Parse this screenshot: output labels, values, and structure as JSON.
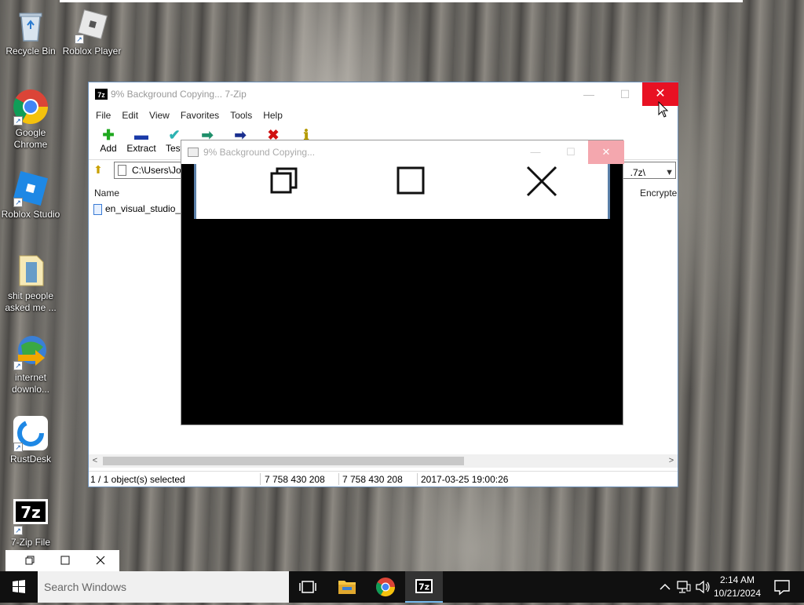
{
  "desktop": {
    "icons": [
      {
        "label": "Recycle Bin"
      },
      {
        "label": "Roblox Player"
      },
      {
        "label": "Google Chrome"
      },
      {
        "label": "Roblox Studio"
      },
      {
        "label": "shit people asked me ..."
      },
      {
        "label": "internet downlo..."
      },
      {
        "label": "RustDesk"
      },
      {
        "label": "7-Zip File"
      }
    ]
  },
  "window": {
    "title": "9% Background Copying... 7-Zip",
    "icon_text": "7z",
    "minimize_glyph": "—",
    "maximize_glyph": "☐",
    "close_glyph": "✕"
  },
  "menu": [
    "File",
    "Edit",
    "View",
    "Favorites",
    "Tools",
    "Help"
  ],
  "toolbar": {
    "buttons": [
      {
        "label": "Add",
        "glyph": "✚",
        "color": "#1fa81f"
      },
      {
        "label": "Extract",
        "glyph": "▬",
        "color": "#1a3aa8"
      },
      {
        "label": "Test",
        "glyph": "✔",
        "color": "#2db3b3"
      },
      {
        "label": "",
        "glyph": "➡",
        "color": "#1f8f6a"
      },
      {
        "label": "",
        "glyph": "➡",
        "color": "#1a2f8f"
      },
      {
        "label": "",
        "glyph": "✖",
        "color": "#d01010"
      },
      {
        "label": "",
        "glyph": "ℹ",
        "color": "#b59a00"
      }
    ]
  },
  "address": {
    "path_start": "C:\\Users\\Jo",
    "path_end": ".7z\\"
  },
  "filelist": {
    "columns": {
      "name": "Name",
      "encrypted": "Encrypte"
    },
    "rows": [
      {
        "name": "en_visual_studio_c"
      }
    ]
  },
  "statusbar": {
    "selection": "1 / 1 object(s) selected",
    "size": "7 758 430 208",
    "packed": "7 758 430 208",
    "modified": "2017-03-25 19:00:26"
  },
  "dialog": {
    "title": "9% Background Copying..."
  },
  "taskbar": {
    "search_placeholder": "Search Windows",
    "time": "2:14 AM",
    "date": "10/21/2024"
  },
  "colors": {
    "close_red": "#e81123",
    "taskbar": "#101010",
    "accent": "#76b9ed"
  }
}
